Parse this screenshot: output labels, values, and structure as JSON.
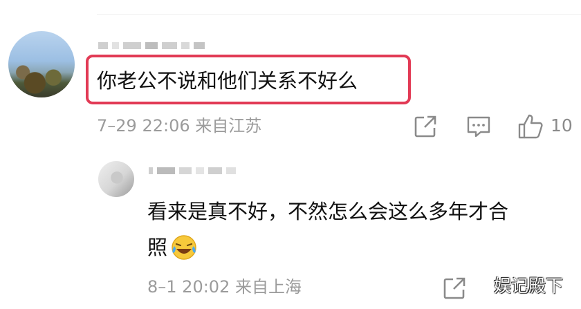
{
  "comment": {
    "text": "你老公不说和他们关系不好么",
    "date": "7–29 22:06",
    "location": "来自江苏",
    "like_count": "10"
  },
  "reply": {
    "text_line1": "看来是真不好，不然怎么会这么多年才合",
    "text_line2": "照",
    "emoji": "laughing-crying-emoji",
    "date": "8–1 20:02",
    "location": "来自上海"
  },
  "watermark": "娱记殿下",
  "colors": {
    "highlight": "#e23a55",
    "meta_text": "#9b9b9b",
    "icon": "#8a8a8a"
  }
}
